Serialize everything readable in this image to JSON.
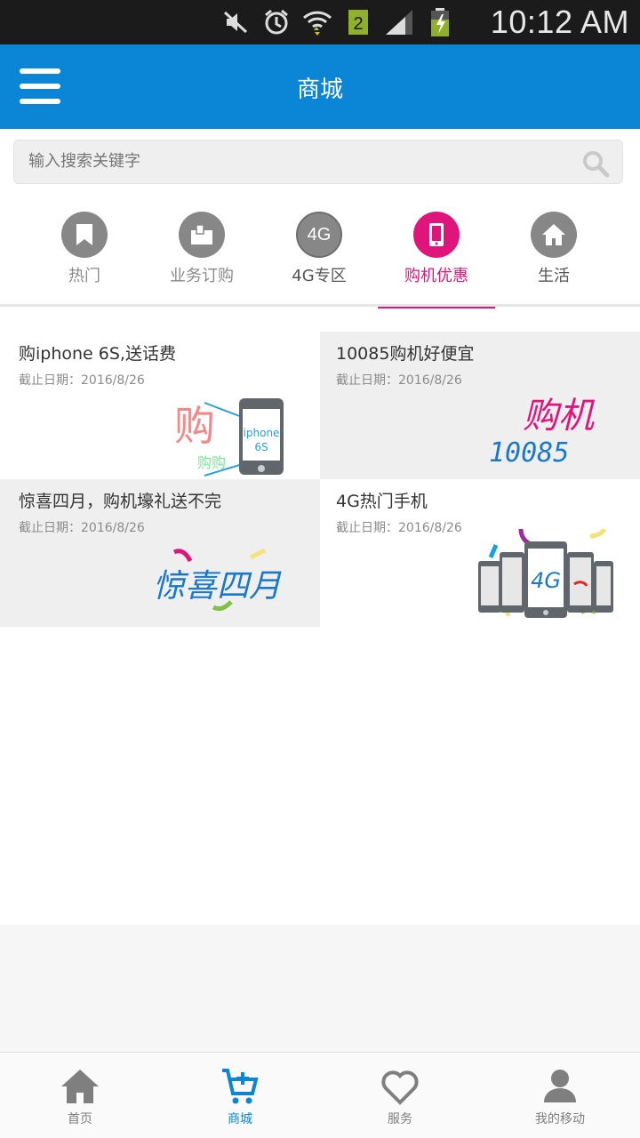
{
  "status_bar": {
    "time": "10:12 AM",
    "sim_slot": "2",
    "icons": [
      "mute-icon",
      "alarm-icon",
      "wifi-icon",
      "sim-icon",
      "signal-icon",
      "battery-icon"
    ]
  },
  "app_bar": {
    "title": "商城",
    "menu_icon": "hamburger-icon"
  },
  "search": {
    "placeholder": "输入搜索关键字",
    "icon": "search-icon"
  },
  "categories": [
    {
      "label": "热门",
      "icon": "bookmark-icon",
      "active": false
    },
    {
      "label": "业务订购",
      "icon": "folder-icon",
      "active": false
    },
    {
      "label": "4G专区",
      "icon": "4g-icon",
      "icon_text": "4G",
      "active": false
    },
    {
      "label": "购机优惠",
      "icon": "phone-icon",
      "active": true
    },
    {
      "label": "生活",
      "icon": "home-icon",
      "active": false
    }
  ],
  "promos": [
    {
      "title": "购iphone 6S,送话费",
      "date": "截止日期：2016/8/26",
      "art": {
        "big_char": "购",
        "small_text": "购购",
        "phone_text": "iphone\n6S"
      }
    },
    {
      "title": "10085购机好便宜",
      "date": "截止日期：2016/8/26",
      "art": {
        "script": "购机",
        "number": "10085"
      }
    },
    {
      "title": "惊喜四月，购机壕礼送不完",
      "date": "截止日期：2016/8/26",
      "art": {
        "script": "惊喜四月"
      }
    },
    {
      "title": "4G热门手机",
      "date": "截止日期：2016/8/26",
      "art": {
        "screen_text": "4G"
      }
    }
  ],
  "bottom_nav": [
    {
      "label": "首页",
      "icon": "home-icon",
      "active": false
    },
    {
      "label": "商城",
      "icon": "cart-icon",
      "active": true
    },
    {
      "label": "服务",
      "icon": "heart-icon",
      "active": false
    },
    {
      "label": "我的移动",
      "icon": "user-icon",
      "active": false
    }
  ],
  "colors": {
    "primary": "#0b86d6",
    "accent": "#e0157c",
    "status_bar": "#1b1b1b",
    "icon_gray": "#878787"
  }
}
